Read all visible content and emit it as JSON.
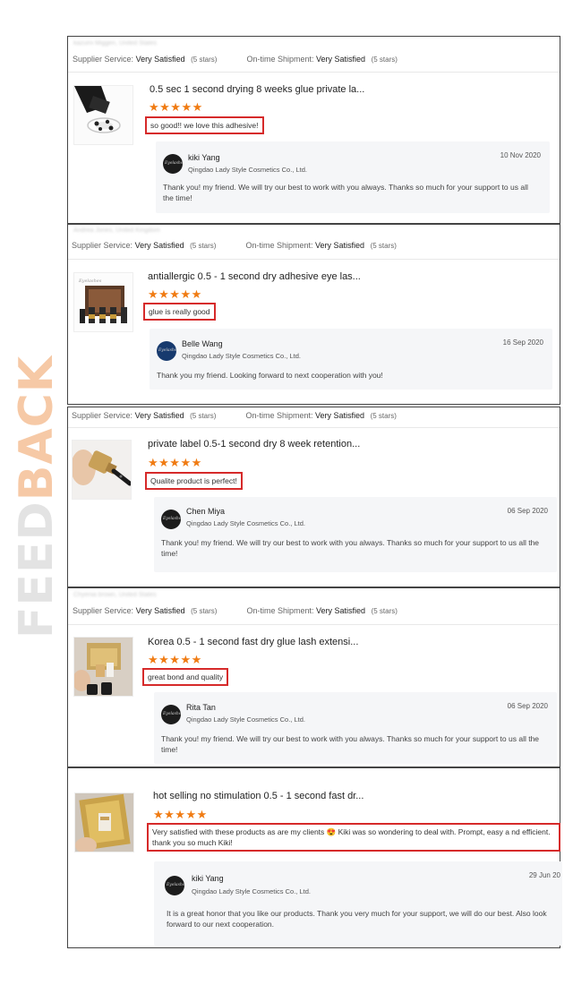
{
  "watermark": {
    "part1": "FEED",
    "part2": "BACK"
  },
  "labels": {
    "supplier_service": "Supplier Service:",
    "on_time_shipment": "On-time Shipment:",
    "very_satisfied": "Very Satisfied",
    "five_stars": "(5 stars)",
    "stars": "★★★★★"
  },
  "reviews": [
    {
      "buyer": "kazumi Miggen, United States",
      "product_title": "0.5 sec 1 second drying 8 weeks glue private la...",
      "rating": 5,
      "comment": "so good!! we love this adhesive!",
      "reply": {
        "name": "kiki Yang",
        "company": "Qingdao Lady Style Cosmetics Co., Ltd.",
        "date": "10 Nov 2020",
        "text": "Thank you! my friend. We will try our best to work with you always. Thanks so much for your support to us all the time!"
      }
    },
    {
      "buyer": "Andrea Jones, United Kingdom",
      "product_title": "antiallergic 0.5 - 1 second dry adhesive eye las...",
      "rating": 5,
      "comment": "glue is really good",
      "reply": {
        "name": "Belle Wang",
        "company": "Qingdao Lady Style Cosmetics Co., Ltd.",
        "date": "16 Sep 2020",
        "text": "Thank you my friend. Looking forward to next cooperation with you!"
      }
    },
    {
      "buyer": "",
      "product_title": "private label 0.5-1 second dry 8 week retention...",
      "rating": 5,
      "comment": "Qualite product is perfect!",
      "reply": {
        "name": "Chen Miya",
        "company": "Qingdao Lady Style Cosmetics Co., Ltd.",
        "date": "06 Sep 2020",
        "text": "Thank you! my friend. We will try our best to work with you always. Thanks so much for your support to us all the time!"
      }
    },
    {
      "buyer": "Chyenia brown, United States",
      "product_title": "Korea 0.5 - 1 second fast dry glue lash extensi...",
      "rating": 5,
      "comment": "great bond and quality",
      "reply": {
        "name": "Rita Tan",
        "company": "Qingdao Lady Style Cosmetics Co., Ltd.",
        "date": "06 Sep 2020",
        "text": "Thank you! my friend. We will try our best to work with you always. Thanks so much for your support to us all the time!"
      }
    },
    {
      "buyer": "",
      "product_title": "hot selling no stimulation 0.5 - 1 second fast dr...",
      "rating": 5,
      "comment": "Very satisfied with these products as are my clients 😍 Kiki was so wondering to deal with. Prompt, easy a nd efficient. thank you so much Kiki!",
      "reply": {
        "name": "kiki Yang",
        "company": "Qingdao Lady Style Cosmetics Co., Ltd.",
        "date": "29 Jun 20",
        "text": "It is a great honor that you like our products. Thank you very much for your support, we will do our best. Also look forward to our next cooperation."
      }
    }
  ]
}
